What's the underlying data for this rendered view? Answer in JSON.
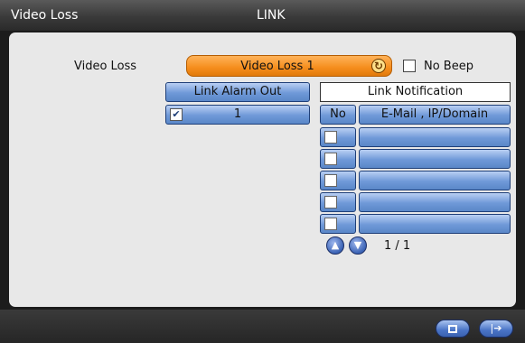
{
  "titlebar": {
    "left": "Video Loss",
    "center": "LINK"
  },
  "video_loss": {
    "label": "Video Loss",
    "selected": "Video Loss 1",
    "no_beep_label": "No Beep",
    "no_beep_checked": false
  },
  "link_alarm_out": {
    "header": "Link Alarm Out",
    "items": [
      {
        "label": "1",
        "checked": true
      }
    ]
  },
  "link_notification": {
    "header": "Link Notification",
    "col_no": "No",
    "col_target": "E-Mail , IP/Domain",
    "rows": [
      {
        "checked": false,
        "value": ""
      },
      {
        "checked": false,
        "value": ""
      },
      {
        "checked": false,
        "value": ""
      },
      {
        "checked": false,
        "value": ""
      },
      {
        "checked": false,
        "value": ""
      }
    ],
    "pager": "1 / 1"
  },
  "icons": {
    "refresh": "refresh-icon",
    "page_up": "chevron-up-icon",
    "page_down": "chevron-down-icon",
    "save": "save-icon",
    "exit": "exit-icon"
  }
}
